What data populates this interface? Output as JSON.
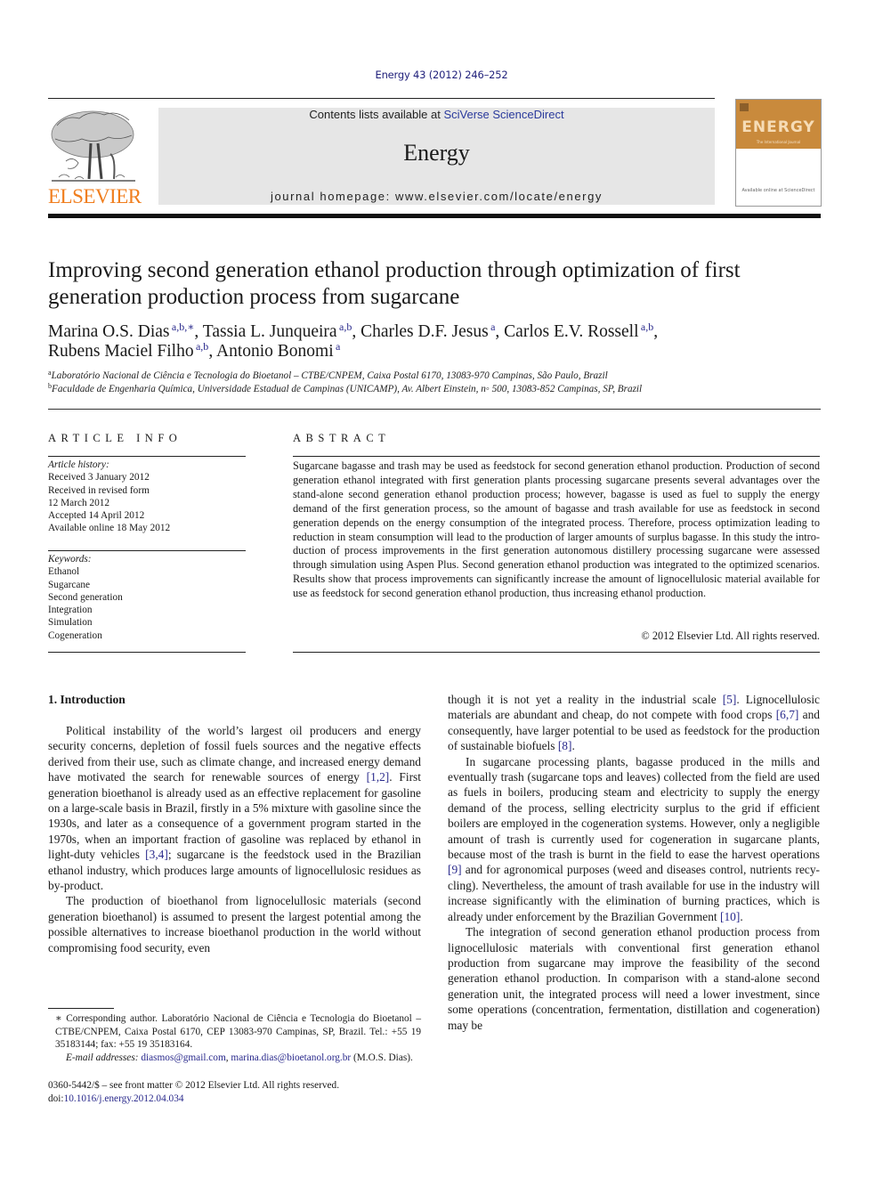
{
  "header": {
    "journal_ref": "Energy 43 (2012) 246–252",
    "contents_prefix": "Contents lists available at ",
    "sciencedirect_link": "SciVerse ScienceDirect",
    "journal_name": "Energy",
    "homepage": "journal homepage: www.elsevier.com/locate/energy",
    "publisher_wordmark": "ELSEVIER",
    "cover_title": "ENERGY",
    "cover_subtitle": "The International Journal",
    "cover_bottom": "Available online at ScienceDirect",
    "colors": {
      "publisher_orange": "#f07e1e",
      "cover_orange": "#c98a3c",
      "link_blue": "#2a2a8c",
      "masthead_grey": "#e6e6e6"
    }
  },
  "article": {
    "title": "Improving second generation ethanol production through optimization of first generation production process from sugarcane",
    "authors": [
      {
        "name": "Marina O.S. Dias",
        "sup": "a,b,∗",
        "sep": ", "
      },
      {
        "name": "Tassia L. Junqueira",
        "sup": "a,b",
        "sep": ", "
      },
      {
        "name": "Charles D.F. Jesus",
        "sup": "a",
        "sep": ", "
      },
      {
        "name": "Carlos E.V. Rossell",
        "sup": "a,b",
        "sep": ","
      },
      {
        "name": "Rubens Maciel Filho",
        "sup": "a,b",
        "sep": ", "
      },
      {
        "name": "Antonio Bonomi",
        "sup": "a",
        "sep": ""
      }
    ],
    "affiliations": [
      {
        "key": "a",
        "text": "Laboratório Nacional de Ciência e Tecnologia do Bioetanol – CTBE/CNPEM, Caixa Postal 6170, 13083-970 Campinas, São Paulo, Brazil"
      },
      {
        "key": "b",
        "text": "Faculdade de Engenharia Química, Universidade Estadual de Campinas (UNICAMP), Av. Albert Einstein, n◦ 500, 13083-852 Campinas, SP, Brazil"
      }
    ]
  },
  "article_info": {
    "heading": "ARTICLE INFO",
    "history_label": "Article history:",
    "history": [
      "Received 3 January 2012",
      "Received in revised form",
      "12 March 2012",
      "Accepted 14 April 2012",
      "Available online 18 May 2012"
    ],
    "keywords_label": "Keywords:",
    "keywords": [
      "Ethanol",
      "Sugarcane",
      "Second generation",
      "Integration",
      "Simulation",
      "Cogeneration"
    ]
  },
  "abstract": {
    "heading": "ABSTRACT",
    "text": "Sugarcane bagasse and trash may be used as feedstock for second generation ethanol production. Production of second generation ethanol integrated with first generation plants processing sugarcane presents several advantages over the stand-alone second generation ethanol production process; however, bagasse is used as fuel to supply the energy demand of the first generation process, so the amount of bagasse and trash available for use as feedstock in second generation depends on the energy consumption of the integrated process. Therefore, process optimization leading to reduction in steam consumption will lead to the production of larger amounts of surplus bagasse. In this study the intro­duction of process improvements in the first generation autonomous distillery processing sugarcane were assessed through simulation using Aspen Plus. Second generation ethanol production was inte­grated to the optimized scenarios. Results show that process improvements can significantly increase the amount of lignocellulosic material available for use as feedstock for second generation ethanol production, thus increasing ethanol production.",
    "copyright": "© 2012 Elsevier Ltd. All rights reserved."
  },
  "introduction": {
    "heading": "1.  Introduction",
    "left_paragraphs": [
      [
        {
          "t": "Political instability of the world’s largest oil producers and energy security concerns, depletion of fossil fuels sources and the negative effects derived from their use, such as climate change, and increased energy demand have motivated the search for renewable sources of energy "
        },
        {
          "ref": "[1,2]"
        },
        {
          "t": ". First generation bioethanol is already used as an effective replacement for gasoline on a large-scale basis in Brazil, firstly in a 5% mixture with gasoline since the 1930s, and later as a consequence of a government program started in the 1970s, when an important fraction of gasoline was replaced by ethanol in light-duty vehicles "
        },
        {
          "ref": "[3,4]"
        },
        {
          "t": "; sugarcane is the feedstock used in the Brazilian ethanol industry, which produces large amounts of lignocellulosic residues as by-product."
        }
      ],
      [
        {
          "t": "The production of bioethanol from lignocelullosic materials (second generation bioethanol) is assumed to present the largest potential among the possible alternatives to increase bioethanol production in the world without compromising food security, even"
        }
      ]
    ],
    "right_paragraphs": [
      [
        {
          "t": "though it is not yet a reality in the industrial scale "
        },
        {
          "ref": "[5]"
        },
        {
          "t": ". Lignocellu­losic materials are abundant and cheap, do not compete with food crops "
        },
        {
          "ref": "[6,7]"
        },
        {
          "t": " and consequently, have larger potential to be used as feedstock for the production of sustainable biofuels "
        },
        {
          "ref": "[8]"
        },
        {
          "t": "."
        }
      ],
      [
        {
          "t": "In sugarcane processing plants, bagasse produced in the mills and eventually trash (sugarcane tops and leaves) collected from the field are used as fuels in boilers, producing steam and electricity to supply the energy demand of the process, selling electricity surplus to the grid if efficient boilers are employed in the cogeneration systems. However, only a negligible amount of trash is currently used for cogeneration in sugarcane plants, because most of the trash is burnt in the field to ease the harvest operations "
        },
        {
          "ref": "[9]"
        },
        {
          "t": " and for agronomical purposes (weed and diseases control, nutrients recy­cling). Nevertheless, the amount of trash available for use in the industry will increase significantly with the elimination of burning practices, which is already under enforcement by the Brazilian Government "
        },
        {
          "ref": "[10]"
        },
        {
          "t": "."
        }
      ],
      [
        {
          "t": "The integration of second generation ethanol production process from lignocellulosic materials with conventional first generation ethanol production from sugarcane may improve the feasibility of the second generation ethanol production. In comparison with a stand-alone second generation unit, the inte­grated process will need a lower investment, since some operations (concentration, fermentation, distillation and cogeneration) may be"
        }
      ]
    ]
  },
  "footnotes": {
    "corresponding": "∗ Corresponding author. Laboratório Nacional de Ciência e Tecnologia do Bioetanol – CTBE/CNPEM, Caixa Postal 6170, CEP 13083-970 Campinas, SP, Brazil. Tel.: +55 19 35183144; fax: +55 19 35183164.",
    "email_label": "E-mail addresses:",
    "email_1": "diasmos@gmail.com",
    "email_sep": ", ",
    "email_2": "marina.dias@bioetanol.org.br",
    "email_suffix": " (M.O.S. Dias).",
    "issn_line": "0360-5442/$ – see front matter © 2012 Elsevier Ltd. All rights reserved.",
    "doi_prefix": "doi:",
    "doi": "10.1016/j.energy.2012.04.034"
  }
}
